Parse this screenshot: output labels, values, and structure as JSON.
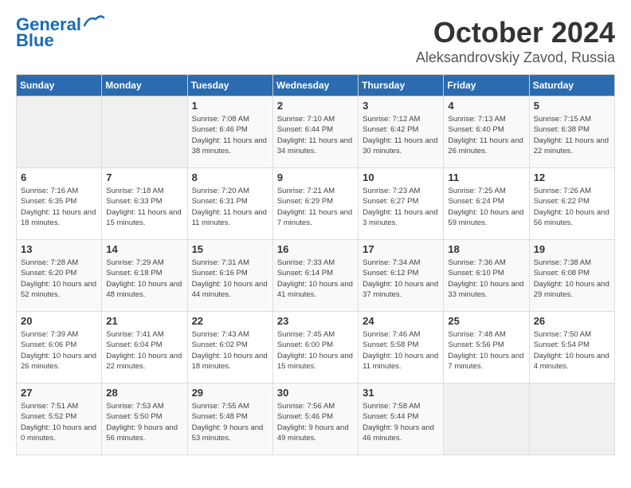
{
  "header": {
    "logo_line1": "General",
    "logo_line2": "Blue",
    "month": "October 2024",
    "location": "Aleksandrovskiy Zavod, Russia"
  },
  "weekdays": [
    "Sunday",
    "Monday",
    "Tuesday",
    "Wednesday",
    "Thursday",
    "Friday",
    "Saturday"
  ],
  "weeks": [
    [
      {
        "day": "",
        "info": ""
      },
      {
        "day": "",
        "info": ""
      },
      {
        "day": "1",
        "info": "Sunrise: 7:08 AM\nSunset: 6:46 PM\nDaylight: 11 hours and 38 minutes."
      },
      {
        "day": "2",
        "info": "Sunrise: 7:10 AM\nSunset: 6:44 PM\nDaylight: 11 hours and 34 minutes."
      },
      {
        "day": "3",
        "info": "Sunrise: 7:12 AM\nSunset: 6:42 PM\nDaylight: 11 hours and 30 minutes."
      },
      {
        "day": "4",
        "info": "Sunrise: 7:13 AM\nSunset: 6:40 PM\nDaylight: 11 hours and 26 minutes."
      },
      {
        "day": "5",
        "info": "Sunrise: 7:15 AM\nSunset: 6:38 PM\nDaylight: 11 hours and 22 minutes."
      }
    ],
    [
      {
        "day": "6",
        "info": "Sunrise: 7:16 AM\nSunset: 6:35 PM\nDaylight: 11 hours and 18 minutes."
      },
      {
        "day": "7",
        "info": "Sunrise: 7:18 AM\nSunset: 6:33 PM\nDaylight: 11 hours and 15 minutes."
      },
      {
        "day": "8",
        "info": "Sunrise: 7:20 AM\nSunset: 6:31 PM\nDaylight: 11 hours and 11 minutes."
      },
      {
        "day": "9",
        "info": "Sunrise: 7:21 AM\nSunset: 6:29 PM\nDaylight: 11 hours and 7 minutes."
      },
      {
        "day": "10",
        "info": "Sunrise: 7:23 AM\nSunset: 6:27 PM\nDaylight: 11 hours and 3 minutes."
      },
      {
        "day": "11",
        "info": "Sunrise: 7:25 AM\nSunset: 6:24 PM\nDaylight: 10 hours and 59 minutes."
      },
      {
        "day": "12",
        "info": "Sunrise: 7:26 AM\nSunset: 6:22 PM\nDaylight: 10 hours and 56 minutes."
      }
    ],
    [
      {
        "day": "13",
        "info": "Sunrise: 7:28 AM\nSunset: 6:20 PM\nDaylight: 10 hours and 52 minutes."
      },
      {
        "day": "14",
        "info": "Sunrise: 7:29 AM\nSunset: 6:18 PM\nDaylight: 10 hours and 48 minutes."
      },
      {
        "day": "15",
        "info": "Sunrise: 7:31 AM\nSunset: 6:16 PM\nDaylight: 10 hours and 44 minutes."
      },
      {
        "day": "16",
        "info": "Sunrise: 7:33 AM\nSunset: 6:14 PM\nDaylight: 10 hours and 41 minutes."
      },
      {
        "day": "17",
        "info": "Sunrise: 7:34 AM\nSunset: 6:12 PM\nDaylight: 10 hours and 37 minutes."
      },
      {
        "day": "18",
        "info": "Sunrise: 7:36 AM\nSunset: 6:10 PM\nDaylight: 10 hours and 33 minutes."
      },
      {
        "day": "19",
        "info": "Sunrise: 7:38 AM\nSunset: 6:08 PM\nDaylight: 10 hours and 29 minutes."
      }
    ],
    [
      {
        "day": "20",
        "info": "Sunrise: 7:39 AM\nSunset: 6:06 PM\nDaylight: 10 hours and 26 minutes."
      },
      {
        "day": "21",
        "info": "Sunrise: 7:41 AM\nSunset: 6:04 PM\nDaylight: 10 hours and 22 minutes."
      },
      {
        "day": "22",
        "info": "Sunrise: 7:43 AM\nSunset: 6:02 PM\nDaylight: 10 hours and 18 minutes."
      },
      {
        "day": "23",
        "info": "Sunrise: 7:45 AM\nSunset: 6:00 PM\nDaylight: 10 hours and 15 minutes."
      },
      {
        "day": "24",
        "info": "Sunrise: 7:46 AM\nSunset: 5:58 PM\nDaylight: 10 hours and 11 minutes."
      },
      {
        "day": "25",
        "info": "Sunrise: 7:48 AM\nSunset: 5:56 PM\nDaylight: 10 hours and 7 minutes."
      },
      {
        "day": "26",
        "info": "Sunrise: 7:50 AM\nSunset: 5:54 PM\nDaylight: 10 hours and 4 minutes."
      }
    ],
    [
      {
        "day": "27",
        "info": "Sunrise: 7:51 AM\nSunset: 5:52 PM\nDaylight: 10 hours and 0 minutes."
      },
      {
        "day": "28",
        "info": "Sunrise: 7:53 AM\nSunset: 5:50 PM\nDaylight: 9 hours and 56 minutes."
      },
      {
        "day": "29",
        "info": "Sunrise: 7:55 AM\nSunset: 5:48 PM\nDaylight: 9 hours and 53 minutes."
      },
      {
        "day": "30",
        "info": "Sunrise: 7:56 AM\nSunset: 5:46 PM\nDaylight: 9 hours and 49 minutes."
      },
      {
        "day": "31",
        "info": "Sunrise: 7:58 AM\nSunset: 5:44 PM\nDaylight: 9 hours and 46 minutes."
      },
      {
        "day": "",
        "info": ""
      },
      {
        "day": "",
        "info": ""
      }
    ]
  ]
}
